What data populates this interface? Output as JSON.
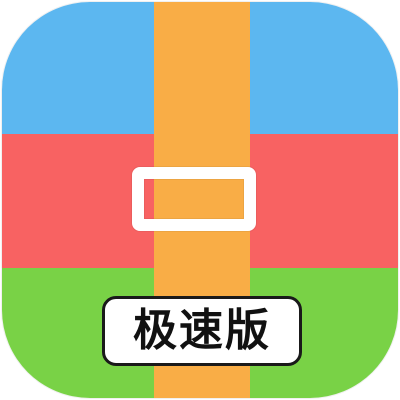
{
  "app_icon": {
    "badge_text": "极速版",
    "colors": {
      "top_band": "#5cb7f0",
      "middle_band": "#f86262",
      "bottom_band": "#79d246",
      "strap": "#f9ad46",
      "buckle": "#ffffff",
      "label_background": "#ffffff",
      "label_text": "#111111"
    },
    "icon_name": "archive-package-icon"
  }
}
